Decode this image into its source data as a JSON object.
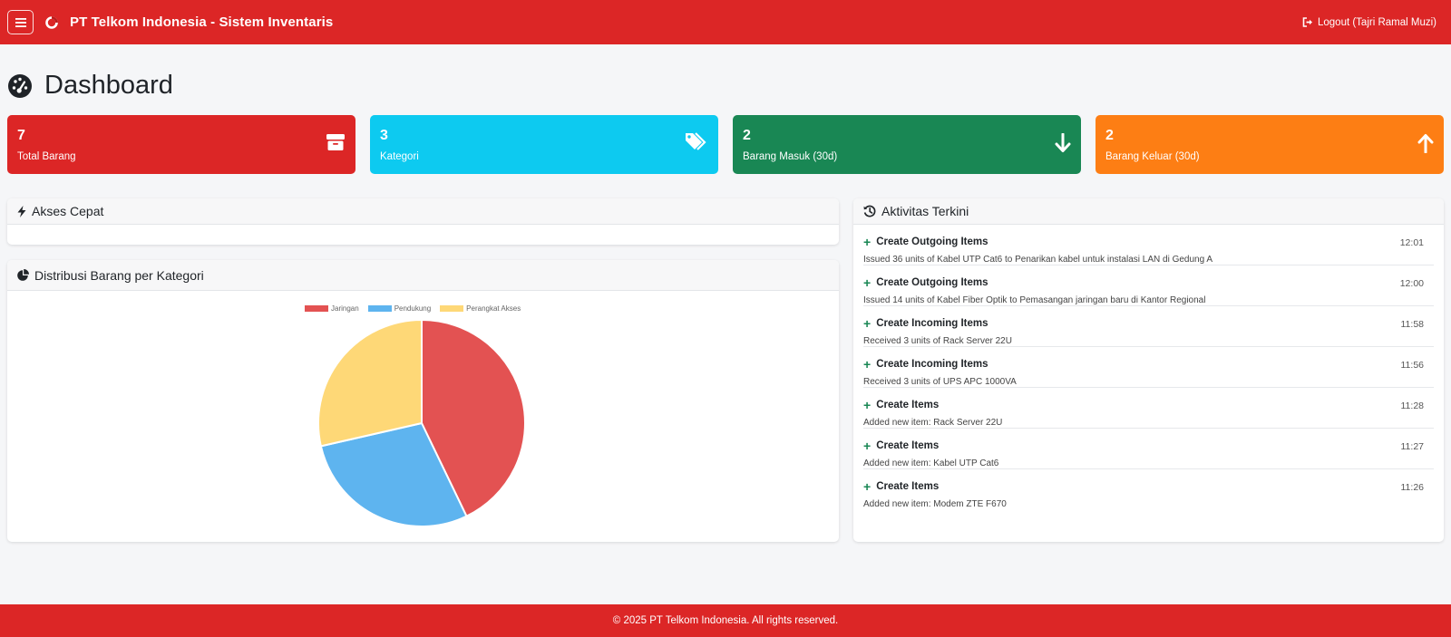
{
  "navbar": {
    "title": "PT Telkom Indonesia - Sistem Inventaris",
    "logout_label": "Logout (Tajri Ramal Muzi)"
  },
  "page": {
    "title": "Dashboard"
  },
  "stats": [
    {
      "value": "7",
      "label": "Total Barang",
      "color": "#dc2626",
      "icon": "box-icon"
    },
    {
      "value": "3",
      "label": "Kategori",
      "color": "#0dcaf0",
      "icon": "tags-icon"
    },
    {
      "value": "2",
      "label": "Barang Masuk (30d)",
      "color": "#198754",
      "icon": "arrow-down-icon"
    },
    {
      "value": "2",
      "label": "Barang Keluar (30d)",
      "color": "#fd7e14",
      "icon": "arrow-up-icon"
    }
  ],
  "quick_access": {
    "title": "Akses Cepat"
  },
  "distribution": {
    "title": "Distribusi Barang per Kategori"
  },
  "chart_data": {
    "type": "pie",
    "categories": [
      "Jaringan",
      "Pendukung",
      "Perangkat Akses"
    ],
    "values": [
      3,
      2,
      2
    ],
    "colors": [
      "#e35252",
      "#5eb4ef",
      "#fed877"
    ],
    "legend": "top"
  },
  "activity": {
    "title": "Aktivitas Terkini",
    "items": [
      {
        "title": "Create Outgoing Items",
        "time": "12:01",
        "desc": "Issued 36 units of Kabel UTP Cat6 to Penarikan kabel untuk instalasi LAN di Gedung A"
      },
      {
        "title": "Create Outgoing Items",
        "time": "12:00",
        "desc": "Issued 14 units of Kabel Fiber Optik to Pemasangan jaringan baru di Kantor Regional"
      },
      {
        "title": "Create Incoming Items",
        "time": "11:58",
        "desc": "Received 3 units of Rack Server 22U"
      },
      {
        "title": "Create Incoming Items",
        "time": "11:56",
        "desc": "Received 3 units of UPS APC 1000VA"
      },
      {
        "title": "Create Items",
        "time": "11:28",
        "desc": "Added new item: Rack Server 22U"
      },
      {
        "title": "Create Items",
        "time": "11:27",
        "desc": "Added new item: Kabel UTP Cat6"
      },
      {
        "title": "Create Items",
        "time": "11:26",
        "desc": "Added new item: Modem ZTE F670"
      }
    ]
  },
  "footer": {
    "text": "© 2025 PT Telkom Indonesia. All rights reserved."
  }
}
